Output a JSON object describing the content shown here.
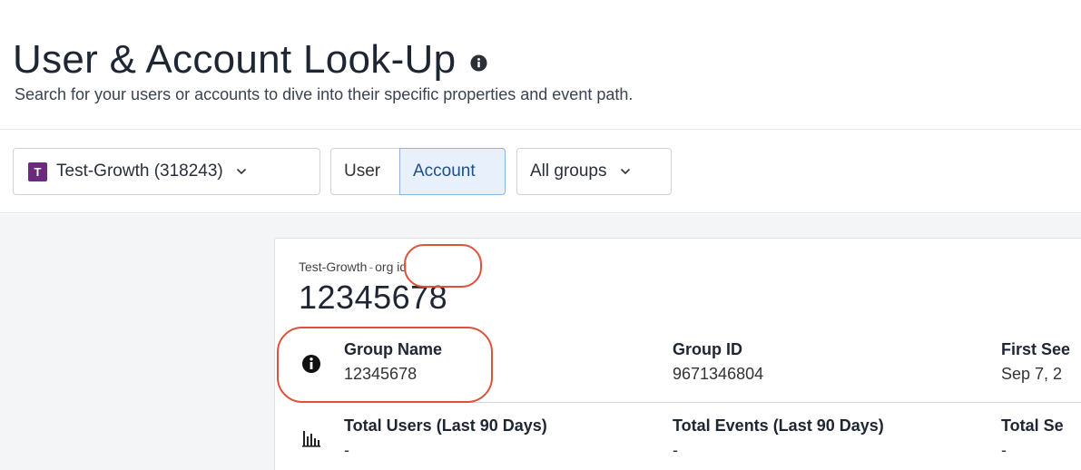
{
  "header": {
    "title": "User & Account Look-Up",
    "subtitle": "Search for your users or accounts to dive into their specific properties and event path."
  },
  "toolbar": {
    "project": {
      "badge": "T",
      "label": "Test-Growth (318243)"
    },
    "segment": [
      {
        "label": "User",
        "active": false
      },
      {
        "label": "Account",
        "active": true
      }
    ],
    "groups_label": "All groups"
  },
  "card": {
    "crumb_project": "Test-Growth",
    "crumb_sep": "-",
    "crumb_type": "org id",
    "id": "12345678",
    "fields_row1": [
      {
        "label": "Group Name",
        "value": "12345678"
      },
      {
        "label": "Group ID",
        "value": "9671346804"
      },
      {
        "label": "First See",
        "value": "Sep 7, 2"
      }
    ],
    "fields_row2": [
      {
        "label": "Total Users (Last 90 Days)",
        "value": "-"
      },
      {
        "label": "Total Events (Last 90 Days)",
        "value": "-"
      },
      {
        "label": "Total Se",
        "value": "-"
      }
    ]
  },
  "icons": {
    "title_info": "info-icon",
    "dropdown": "chevron-down-icon",
    "row1": "info-icon",
    "row2": "bar-chart-icon"
  },
  "colors": {
    "project_badge": "#6b2a7e",
    "active_segment_bg": "#e8f1fb",
    "active_segment_text": "#1d4f8c",
    "annotation": "#e0503a"
  }
}
